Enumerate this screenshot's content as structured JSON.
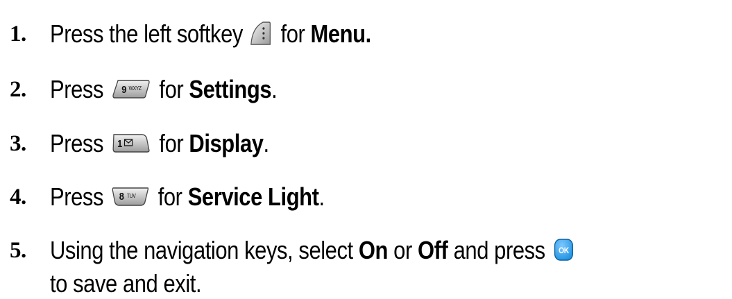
{
  "steps": [
    {
      "number": "1.",
      "before": "Press the left softkey",
      "after": " for ",
      "bold": "Menu.",
      "tail": "",
      "key_icon": "left-softkey-icon"
    },
    {
      "number": "2.",
      "before": "Press",
      "after": " for ",
      "bold": "Settings",
      "tail": ".",
      "key_icon": "key-9-wxyz-icon",
      "key_label": "9",
      "key_sub": "WXYZ"
    },
    {
      "number": "3.",
      "before": "Press",
      "after": " for ",
      "bold": "Display",
      "tail": ".",
      "key_icon": "key-1-voicemail-icon",
      "key_label": "1"
    },
    {
      "number": "4.",
      "before": "Press",
      "after": " for ",
      "bold": "Service Light",
      "tail": ".",
      "key_icon": "key-8-tuv-icon",
      "key_label": "8",
      "key_sub": "TUV"
    },
    {
      "number": "5.",
      "before": "Using the navigation keys, select ",
      "bold_a": "On",
      "mid": " or ",
      "bold_b": "Off",
      "after": " and press",
      "line2": "to save and exit.",
      "key_icon": "ok-key-icon",
      "key_label": "OK"
    }
  ],
  "colors": {
    "text": "#000000",
    "ok_key": "#1a8fe0"
  }
}
